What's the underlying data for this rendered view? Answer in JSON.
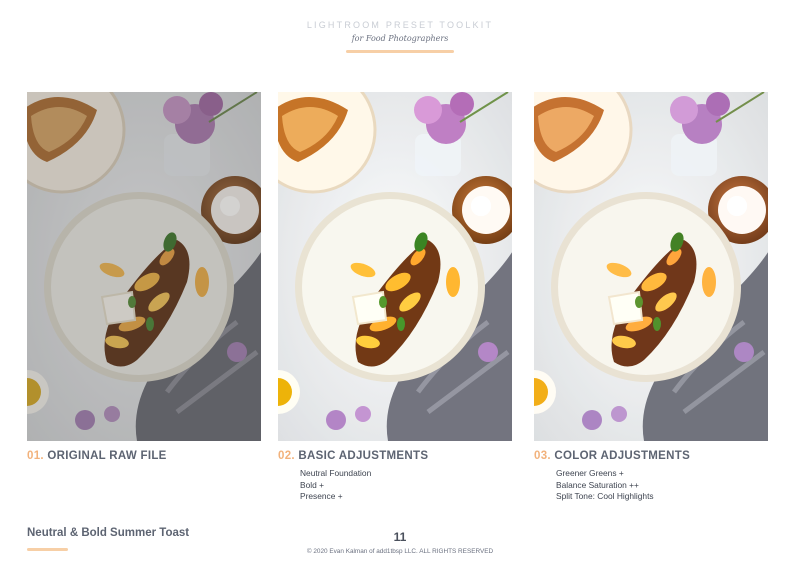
{
  "header": {
    "title": "LIGHTROOM PRESET TOOLKIT",
    "subtitle": "for Food Photographers"
  },
  "panels": [
    {
      "number": "01.",
      "heading": "ORIGINAL RAW FILE",
      "items": [],
      "image_alt": "Overhead photo of peach toast with brie on a plate, unedited raw file"
    },
    {
      "number": "02.",
      "heading": "BASIC ADJUSTMENTS",
      "items": [
        "Neutral Foundation",
        "Bold +",
        "Presence +"
      ],
      "image_alt": "Same photo with basic adjustments applied"
    },
    {
      "number": "03.",
      "heading": "COLOR ADJUSTMENTS",
      "items": [
        "Greener Greens +",
        "Balance Saturation ++",
        "Split Tone: Cool Highlights"
      ],
      "image_alt": "Same photo with color adjustments applied"
    }
  ],
  "footer": {
    "recipe_title": "Neutral & Bold Summer Toast",
    "page_number": "11",
    "copyright": "© 2020 Evan Kalman of add1tbsp LLC. ALL RIGHTS RESERVED"
  },
  "colors": {
    "accent": "#f2b27c",
    "accent_light": "#f7cfa6",
    "text": "#5d6472"
  },
  "image_filters": [
    "brightness(0.86) saturate(0.85) contrast(0.95)",
    "brightness(1.05) saturate(1.08) contrast(1.05)",
    "brightness(1.04) saturate(1.0) contrast(1.06) hue-rotate(-4deg)"
  ]
}
